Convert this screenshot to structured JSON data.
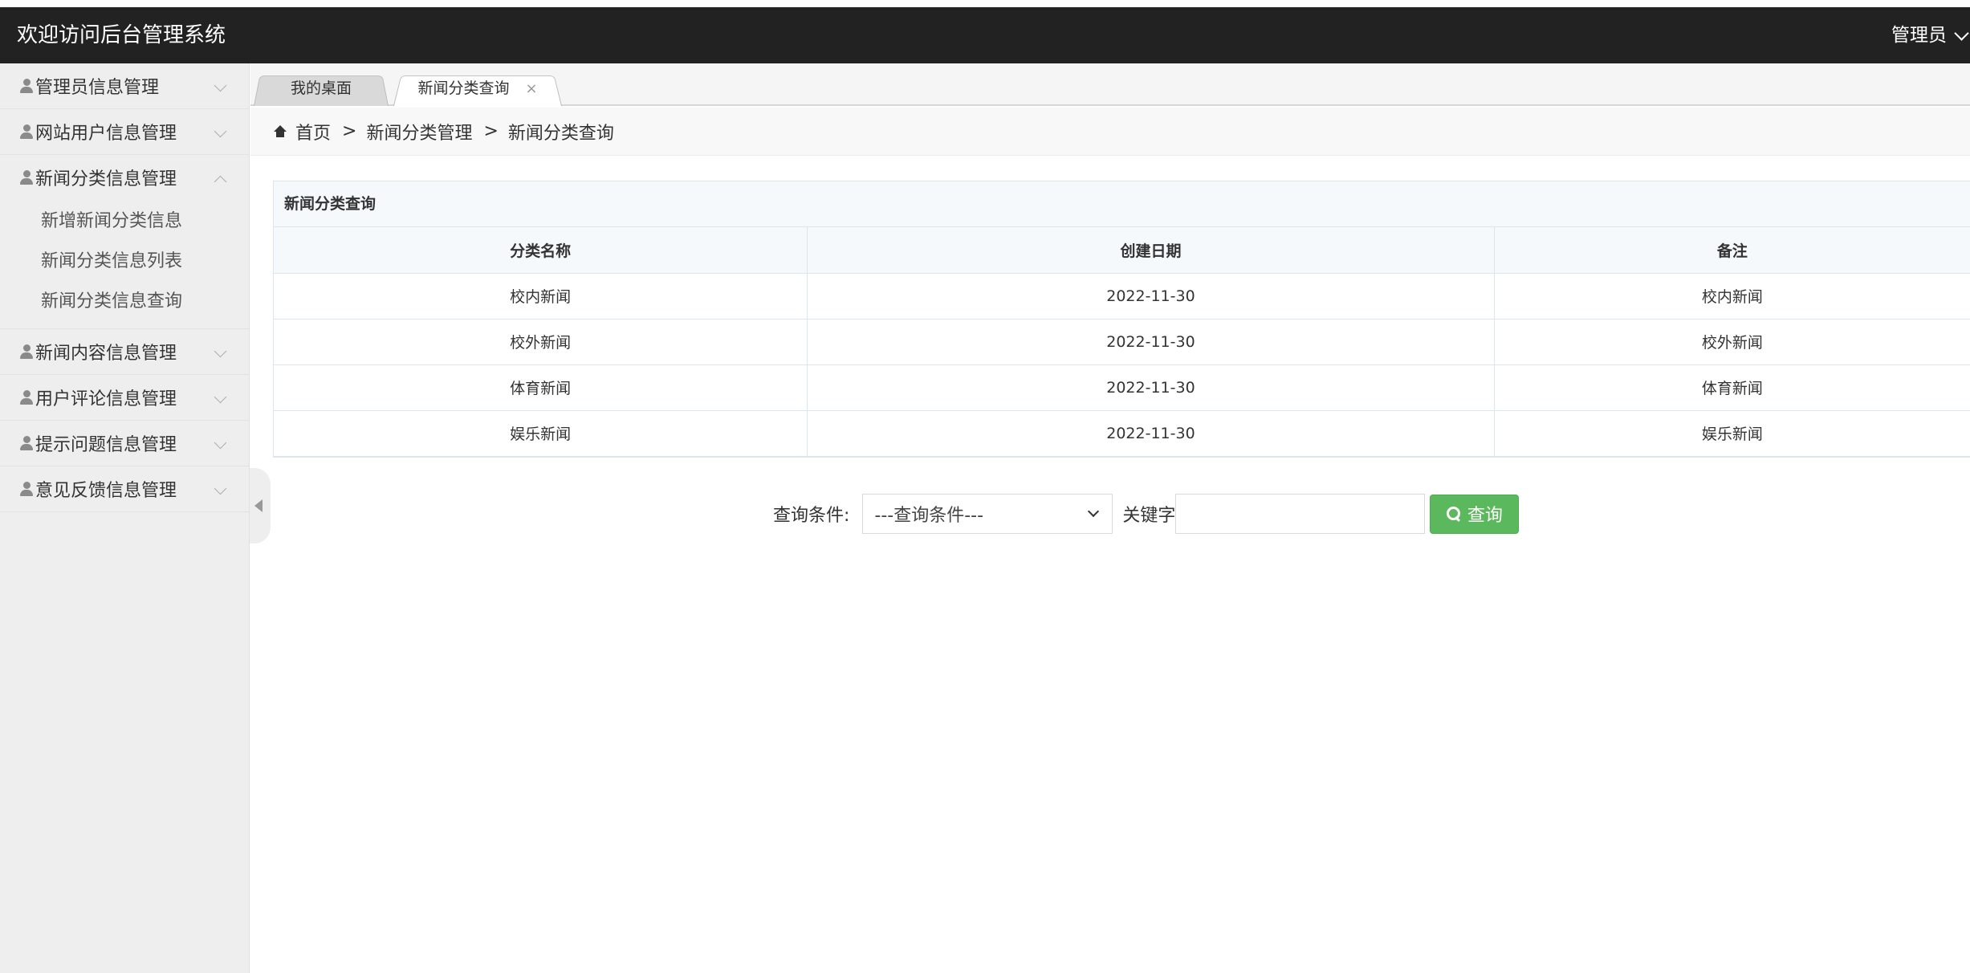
{
  "header": {
    "title": "欢迎访问后台管理系统",
    "user_label": "管理员"
  },
  "sidebar": {
    "groups": [
      {
        "label": "管理员信息管理",
        "expanded": false
      },
      {
        "label": "网站用户信息管理",
        "expanded": false
      },
      {
        "label": "新闻分类信息管理",
        "expanded": true,
        "items": [
          "新增新闻分类信息",
          "新闻分类信息列表",
          "新闻分类信息查询"
        ]
      },
      {
        "label": "新闻内容信息管理",
        "expanded": false
      },
      {
        "label": "用户评论信息管理",
        "expanded": false
      },
      {
        "label": "提示问题信息管理",
        "expanded": false
      },
      {
        "label": "意见反馈信息管理",
        "expanded": false
      }
    ]
  },
  "tabs": [
    {
      "label": "我的桌面",
      "active": false
    },
    {
      "label": "新闻分类查询",
      "active": true,
      "close": "×"
    }
  ],
  "breadcrumb": {
    "home": "首页",
    "separator": ">",
    "level1": "新闻分类管理",
    "level2": "新闻分类查询"
  },
  "panel": {
    "title": "新闻分类查询",
    "columns": [
      "分类名称",
      "创建日期",
      "备注"
    ],
    "rows": [
      [
        "校内新闻",
        "2022-11-30",
        "校内新闻"
      ],
      [
        "校外新闻",
        "2022-11-30",
        "校外新闻"
      ],
      [
        "体育新闻",
        "2022-11-30",
        "体育新闻"
      ],
      [
        "娱乐新闻",
        "2022-11-30",
        "娱乐新闻"
      ]
    ]
  },
  "search": {
    "condition_label": "查询条件:",
    "condition_selected": "---查询条件---",
    "keyword_label": "关键字",
    "keyword_value": "",
    "button_label": "查询"
  },
  "colors": {
    "topbar": "#222222",
    "sidebar": "#eeeeee",
    "search_button": "#5cb85c",
    "table_header_bg": "#f5f9fc"
  }
}
